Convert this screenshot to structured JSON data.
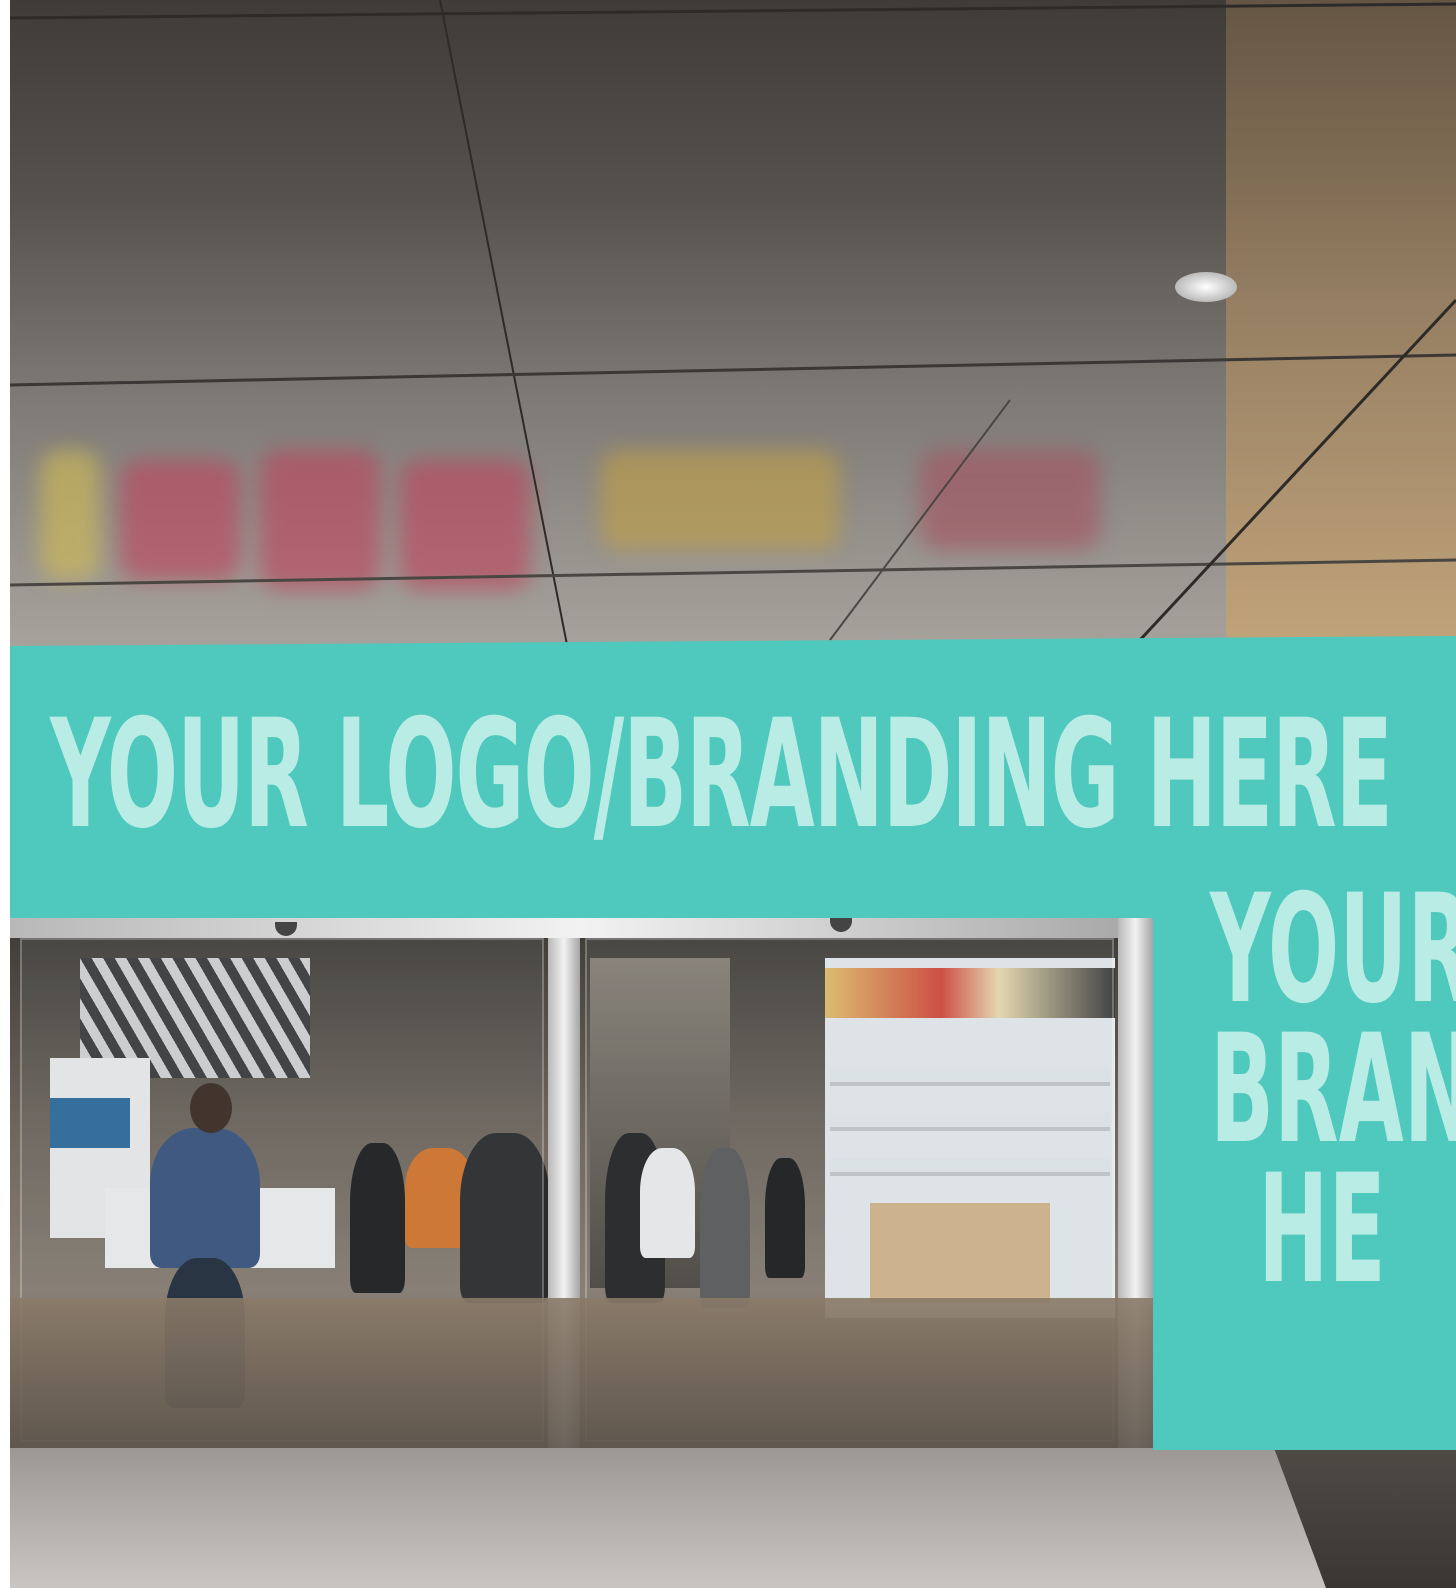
{
  "banner": {
    "top_text": "YOUR LOGO/BRANDING HERE",
    "side_lines": [
      "YOUR",
      "BRAN",
      "HE"
    ],
    "color": "#4fc8bd",
    "text_color": "#b9ece4"
  }
}
